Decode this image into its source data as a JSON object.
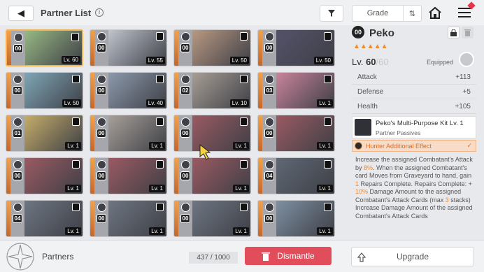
{
  "header": {
    "title": "Partner List",
    "info_icon": "i",
    "sort_label": "Grade",
    "sort_dir_icon": "sort-icon"
  },
  "grid": {
    "cards": [
      {
        "rank": "00",
        "level": "Lv. 60",
        "selected": true,
        "color": "#97b884"
      },
      {
        "rank": "00",
        "level": "Lv. 55",
        "color": "#bfc4cd"
      },
      {
        "rank": "00",
        "level": "Lv. 50",
        "color": "#b89982"
      },
      {
        "rank": "00",
        "level": "Lv. 50",
        "color": "#54526a"
      },
      {
        "rank": "00",
        "level": "Lv. 50",
        "color": "#7fa6b6"
      },
      {
        "rank": "00",
        "level": "Lv. 40",
        "color": "#8c9aac"
      },
      {
        "rank": "02",
        "level": "Lv. 10",
        "color": "#a79e95"
      },
      {
        "rank": "03",
        "level": "Lv. 1",
        "color": "#c9849b"
      },
      {
        "rank": "01",
        "level": "Lv. 1",
        "color": "#c5ad6a"
      },
      {
        "rank": "00",
        "level": "Lv. 1",
        "color": "#a7a099"
      },
      {
        "rank": "00",
        "level": "Lv. 1",
        "color": "#9b5a62"
      },
      {
        "rank": "00",
        "level": "Lv. 1",
        "color": "#9b5a62"
      },
      {
        "rank": "00",
        "level": "Lv. 1",
        "color": "#9b5a62"
      },
      {
        "rank": "00",
        "level": "Lv. 1",
        "color": "#9b5a62"
      },
      {
        "rank": "00",
        "level": "Lv. 1",
        "color": "#9b5a62"
      },
      {
        "rank": "04",
        "level": "Lv. 1",
        "color": "#5f6874"
      },
      {
        "rank": "04",
        "level": "Lv. 1",
        "color": "#6e7682"
      },
      {
        "rank": "00",
        "level": "Lv. 1",
        "color": "#6e7682"
      },
      {
        "rank": "00",
        "level": "Lv. 1",
        "color": "#6e7682"
      },
      {
        "rank": "00",
        "level": "Lv. 1",
        "color": "#7e90a2"
      }
    ]
  },
  "detail": {
    "rank": "00",
    "name": "Peko",
    "stars": "▲▲▲▲▲",
    "level_prefix": "Lv. ",
    "level": "60",
    "level_sep": "/",
    "level_max": "60",
    "equipped": "Equipped",
    "stats": [
      {
        "label": "Attack",
        "value": "+113"
      },
      {
        "label": "Defense",
        "value": "+5"
      },
      {
        "label": "Health",
        "value": "+105"
      }
    ],
    "skill_name": "Peko's Multi-Purpose Kit Lv. 1",
    "skill_sub": "Partner Passives",
    "effect": "Hunter Additional Effect",
    "desc": [
      {
        "t": "Increase the assigned Combatant's Attack by "
      },
      {
        "t": "8%",
        "o": true
      },
      {
        "t": ". When the assigned Combatant's card Moves from Graveyard to hand, gain "
      },
      {
        "t": "1",
        "o": true
      },
      {
        "t": " Repairs Complete. Repairs Complete: + "
      },
      {
        "t": "10%",
        "o": true
      },
      {
        "t": " Damage Amount to the assigned Combatant's Attack Cards (max "
      },
      {
        "t": "3",
        "o": true
      },
      {
        "t": " stacks) Increase Damage Amount of the assigned Combatant's Attack Cards"
      }
    ]
  },
  "footer": {
    "partners_label": "Partners",
    "count": "437 / 1000",
    "dismantle": "Dismantle",
    "upgrade": "Upgrade"
  },
  "colors": {
    "accent": "#f08a2c",
    "danger": "#e24d5c"
  }
}
